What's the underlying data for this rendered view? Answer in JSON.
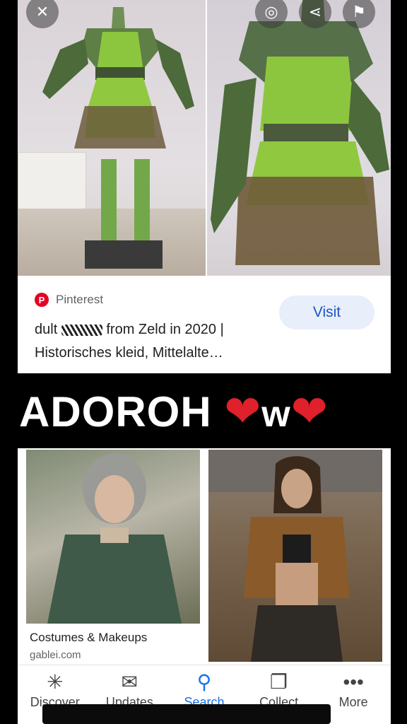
{
  "top_buttons": {
    "close_icon": "close-icon",
    "lens_icon": "lens-icon",
    "share_icon": "share-icon",
    "bookmark_icon": "bookmark-icon"
  },
  "result_card": {
    "source": "Pinterest",
    "visit_label": "Visit",
    "title_line1_prefix": "dult",
    "title_line1_suffix": "from Zeld in 2020 |",
    "title_line2": "Historisches kleid, Mittelalte…"
  },
  "overlay": {
    "text": "ADOROH ",
    "heart1": "❤",
    "w": "w",
    "heart2": "❤"
  },
  "second_result": {
    "title": "Costumes & Makeups",
    "domain": "gablei.com"
  },
  "bottom_nav": [
    {
      "label": "Discover",
      "icon": "asterisk-icon",
      "glyph": "✳"
    },
    {
      "label": "Updates",
      "icon": "inbox-icon",
      "glyph": "✉"
    },
    {
      "label": "Search",
      "icon": "search-icon",
      "glyph": "⚲"
    },
    {
      "label": "Collect",
      "icon": "collections-icon",
      "glyph": "❐"
    },
    {
      "label": "More",
      "icon": "more-icon",
      "glyph": "•••"
    }
  ],
  "colors": {
    "accent": "#1a73e8",
    "visit_bg": "#e8eefa",
    "pinterest": "#e60023",
    "heart": "#e0202a"
  }
}
